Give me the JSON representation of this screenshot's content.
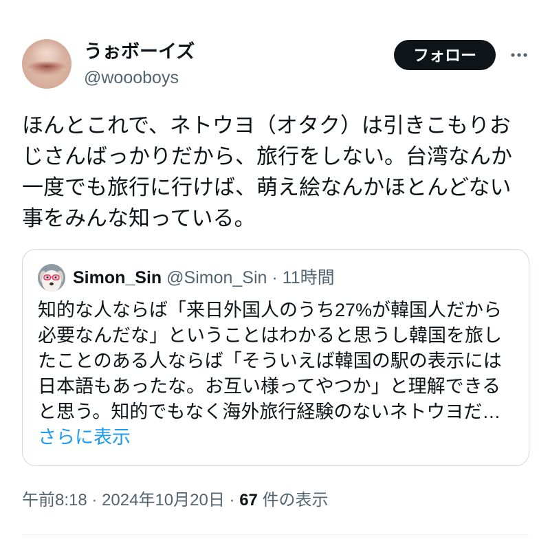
{
  "tweet": {
    "author": {
      "display_name": "うぉボーイズ",
      "handle": "@woooboys"
    },
    "follow_label": "フォロー",
    "more_icon": "more-horizontal-icon",
    "text_lines": [
      "ほんとこれで、ネトウヨ（オタク）は引きこもりお",
      "じさんばっかりだから、旅行をしない。台湾なんか",
      "一度でも旅行に行けば、萌え絵なんかほとんどない",
      "事をみんな知っている。"
    ],
    "quote": {
      "display_name": "Simon_Sin",
      "handle": "@Simon_Sin",
      "separator": "·",
      "time_ago": "11時間",
      "text_lines": [
        "知的な人ならば「来日外国人のうち27%が韓国人だから",
        "必要なんだな」ということはわかると思うし韓国を旅し",
        "たことのある人ならば「そういえば韓国の駅の表示には",
        "日本語もあったな。お互い様ってやつか」と理解できる",
        "と思う。知的でもなく海外旅行経験のないネトウヨだ…"
      ],
      "show_more_label": "さらに表示"
    },
    "meta": {
      "time": "午前8:18",
      "separator": "·",
      "date": "2024年10月20日",
      "views_count": "67",
      "views_label": "件の表示"
    }
  },
  "colors": {
    "text_primary": "#0f1419",
    "text_secondary": "#536471",
    "link": "#1d9bf0",
    "border": "#cfd9de",
    "divider": "#eff3f4",
    "follow_button_bg": "#0f1419",
    "follow_button_text": "#ffffff",
    "background": "#ffffff"
  }
}
